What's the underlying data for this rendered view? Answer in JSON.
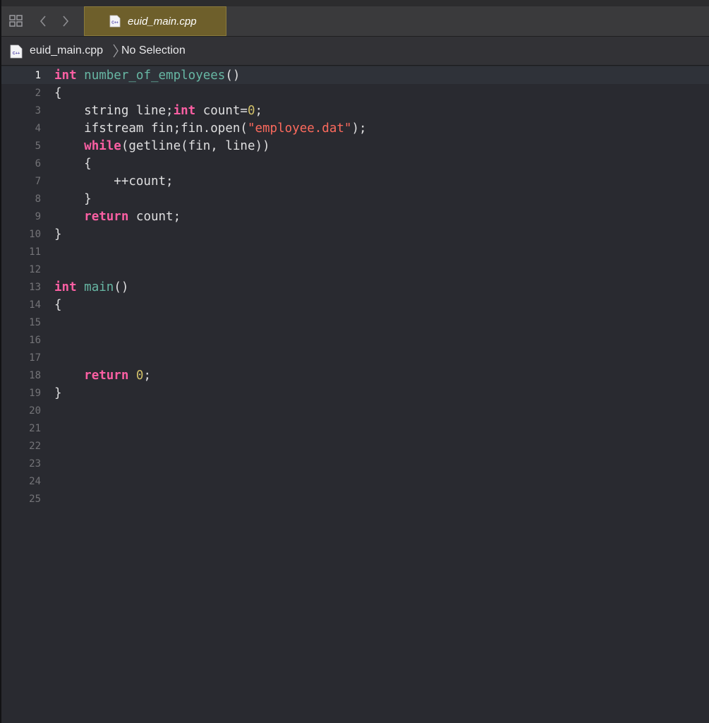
{
  "tabbar": {
    "active_tab": "euid_main.cpp",
    "grid_icon": "related-items-grid-icon",
    "back_icon": "chevron-left-icon",
    "forward_icon": "chevron-right-icon"
  },
  "jumpbar": {
    "file": "euid_main.cpp",
    "selection": "No Selection"
  },
  "file_icon_label": "C++",
  "colors": {
    "keyword": "#fc5fa3",
    "function": "#67b7a4",
    "number": "#d0bf69",
    "string": "#fc6a5d",
    "text": "#dfdfe0",
    "tab_active": "#6e5f2b",
    "background": "#292a30"
  },
  "editor": {
    "active_line": "1",
    "line_numbers": [
      "1",
      "2",
      "3",
      "4",
      "5",
      "6",
      "7",
      "8",
      "9",
      "10",
      "11",
      "12",
      "13",
      "14",
      "15",
      "16",
      "17",
      "18",
      "19",
      "20",
      "21",
      "22",
      "23",
      "24",
      "25"
    ],
    "lines": [
      [
        {
          "t": "int",
          "c": "kw"
        },
        {
          "t": " ",
          "c": "plain"
        },
        {
          "t": "number_of_employees",
          "c": "fn"
        },
        {
          "t": "()",
          "c": "plain"
        }
      ],
      [
        {
          "t": "{",
          "c": "plain"
        }
      ],
      [
        {
          "t": "    string line;",
          "c": "plain"
        },
        {
          "t": "int",
          "c": "kw"
        },
        {
          "t": " count=",
          "c": "plain"
        },
        {
          "t": "0",
          "c": "num"
        },
        {
          "t": ";",
          "c": "plain"
        }
      ],
      [
        {
          "t": "    ifstream fin;fin.open(",
          "c": "plain"
        },
        {
          "t": "\"employee.dat\"",
          "c": "str"
        },
        {
          "t": ");",
          "c": "plain"
        }
      ],
      [
        {
          "t": "    ",
          "c": "plain"
        },
        {
          "t": "while",
          "c": "kw"
        },
        {
          "t": "(getline(fin, line))",
          "c": "plain"
        }
      ],
      [
        {
          "t": "    {",
          "c": "plain"
        }
      ],
      [
        {
          "t": "        ++count;",
          "c": "plain"
        }
      ],
      [
        {
          "t": "    }",
          "c": "plain"
        }
      ],
      [
        {
          "t": "    ",
          "c": "plain"
        },
        {
          "t": "return",
          "c": "kw"
        },
        {
          "t": " count;",
          "c": "plain"
        }
      ],
      [
        {
          "t": "}",
          "c": "plain"
        }
      ],
      [],
      [],
      [
        {
          "t": "int",
          "c": "kw"
        },
        {
          "t": " ",
          "c": "plain"
        },
        {
          "t": "main",
          "c": "fn"
        },
        {
          "t": "()",
          "c": "plain"
        }
      ],
      [
        {
          "t": "{",
          "c": "plain"
        }
      ],
      [],
      [],
      [],
      [
        {
          "t": "    ",
          "c": "plain"
        },
        {
          "t": "return",
          "c": "kw"
        },
        {
          "t": " ",
          "c": "plain"
        },
        {
          "t": "0",
          "c": "num"
        },
        {
          "t": ";",
          "c": "plain"
        }
      ],
      [
        {
          "t": "}",
          "c": "plain"
        }
      ],
      [],
      [],
      [],
      [],
      [],
      []
    ]
  }
}
